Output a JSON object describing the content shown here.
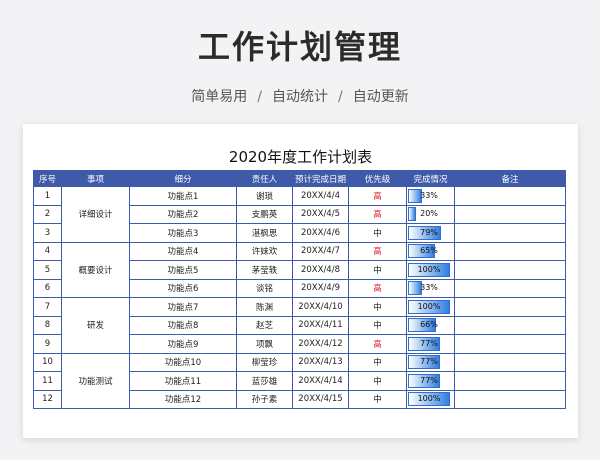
{
  "header": {
    "title": "工作计划管理",
    "tags": [
      "简单易用",
      "自动统计",
      "自动更新"
    ],
    "separator": "/"
  },
  "sheet": {
    "title": "2020年度工作计划表",
    "columns": [
      "序号",
      "事项",
      "细分",
      "责任人",
      "预计完成日期",
      "优先级",
      "完成情况",
      "备注"
    ],
    "groups": [
      {
        "name": "详细设计",
        "start": 0,
        "span": 3
      },
      {
        "name": "概要设计",
        "start": 3,
        "span": 3
      },
      {
        "name": "研发",
        "start": 6,
        "span": 3
      },
      {
        "name": "功能测试",
        "start": 9,
        "span": 3
      }
    ],
    "rows": [
      {
        "no": "1",
        "task": "功能点1",
        "owner": "谢琐",
        "date": "20XX/4/4",
        "priority": "高",
        "progress": "33%",
        "pct": 33,
        "note": ""
      },
      {
        "no": "2",
        "task": "功能点2",
        "owner": "支鹏英",
        "date": "20XX/4/5",
        "priority": "高",
        "progress": "20%",
        "pct": 20,
        "note": ""
      },
      {
        "no": "3",
        "task": "功能点3",
        "owner": "湛枫思",
        "date": "20XX/4/6",
        "priority": "中",
        "progress": "79%",
        "pct": 79,
        "note": ""
      },
      {
        "no": "4",
        "task": "功能点4",
        "owner": "许妹欢",
        "date": "20XX/4/7",
        "priority": "高",
        "progress": "65%",
        "pct": 65,
        "note": ""
      },
      {
        "no": "5",
        "task": "功能点5",
        "owner": "茅莹轶",
        "date": "20XX/4/8",
        "priority": "中",
        "progress": "100%",
        "pct": 100,
        "note": ""
      },
      {
        "no": "6",
        "task": "功能点6",
        "owner": "谈铭",
        "date": "20XX/4/9",
        "priority": "高",
        "progress": "33%",
        "pct": 33,
        "note": ""
      },
      {
        "no": "7",
        "task": "功能点7",
        "owner": "陈渊",
        "date": "20XX/4/10",
        "priority": "中",
        "progress": "100%",
        "pct": 100,
        "note": ""
      },
      {
        "no": "8",
        "task": "功能点8",
        "owner": "赵芝",
        "date": "20XX/4/11",
        "priority": "中",
        "progress": "66%",
        "pct": 66,
        "note": ""
      },
      {
        "no": "9",
        "task": "功能点9",
        "owner": "项飘",
        "date": "20XX/4/12",
        "priority": "高",
        "progress": "77%",
        "pct": 77,
        "note": ""
      },
      {
        "no": "10",
        "task": "功能点10",
        "owner": "柳莹珍",
        "date": "20XX/4/13",
        "priority": "中",
        "progress": "77%",
        "pct": 77,
        "note": ""
      },
      {
        "no": "11",
        "task": "功能点11",
        "owner": "蓝莎雄",
        "date": "20XX/4/14",
        "priority": "中",
        "progress": "77%",
        "pct": 77,
        "note": ""
      },
      {
        "no": "12",
        "task": "功能点12",
        "owner": "孙子素",
        "date": "20XX/4/15",
        "priority": "中",
        "progress": "100%",
        "pct": 100,
        "note": ""
      }
    ]
  },
  "colors": {
    "header_bg": "#3e5aa8",
    "high_priority": "#d8262d",
    "bar": "#2f7fe0"
  }
}
